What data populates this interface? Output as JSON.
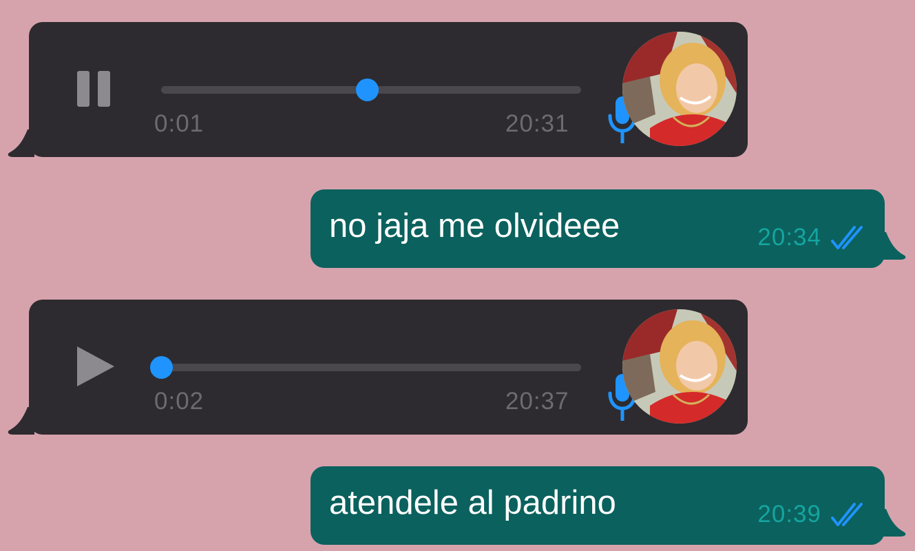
{
  "conversation": {
    "messages": [
      {
        "type": "voice",
        "direction": "incoming",
        "playback_state": "pause",
        "duration": "0:01",
        "time": "20:31",
        "progress": 0.49,
        "avatar_icon": "contact-avatar"
      },
      {
        "type": "text",
        "direction": "outgoing",
        "text": "no jaja me olvideee",
        "time": "20:34",
        "status": "read",
        "status_icon": "double-check-icon"
      },
      {
        "type": "voice",
        "direction": "incoming",
        "playback_state": "play",
        "duration": "0:02",
        "time": "20:37",
        "progress": 0.0,
        "avatar_icon": "contact-avatar"
      },
      {
        "type": "text",
        "direction": "outgoing",
        "text": "atendele al padrino",
        "time": "20:39",
        "status": "read",
        "status_icon": "double-check-icon"
      }
    ]
  },
  "colors": {
    "background": "#d6a3ad",
    "incoming_bubble": "#2d2b2f",
    "outgoing_bubble": "#0b615d",
    "accent": "#1f94ff",
    "timestamp_outgoing": "#14a5a1"
  }
}
